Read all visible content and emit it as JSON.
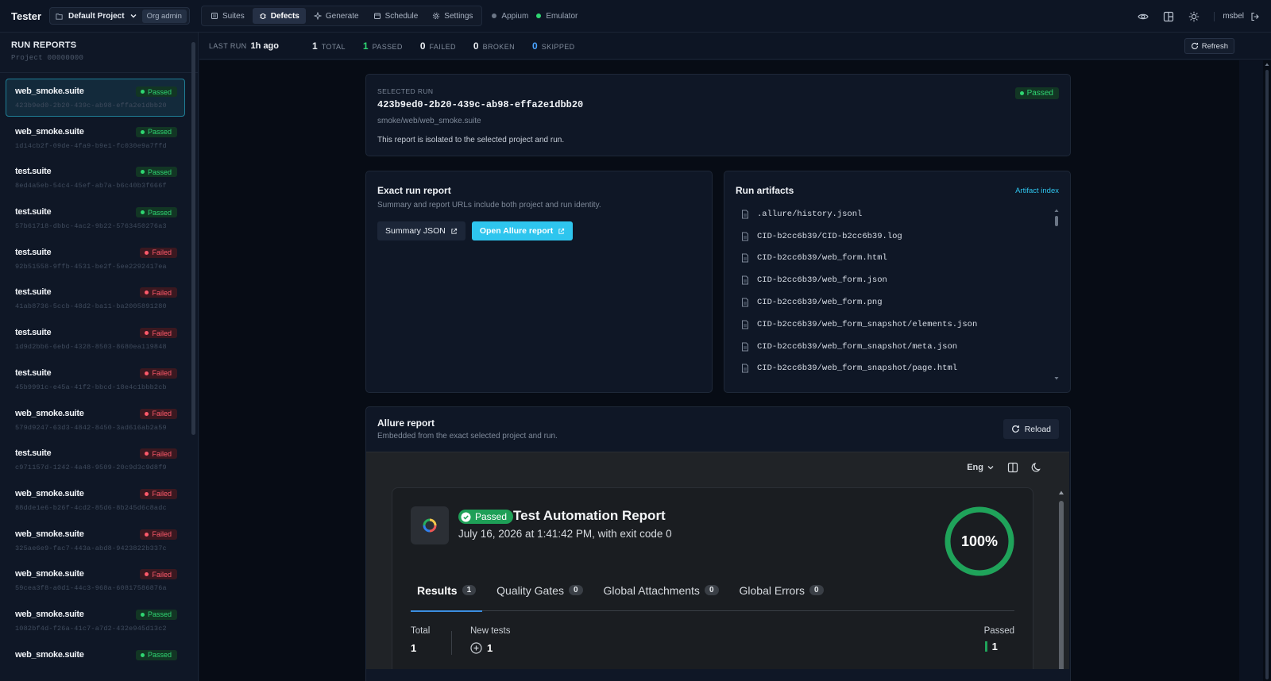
{
  "app": {
    "brand": "Tester"
  },
  "project": {
    "name": "Default Project",
    "org_badge": "Org admin"
  },
  "nav": [
    {
      "label": "Suites",
      "icon": "list-icon",
      "active": false
    },
    {
      "label": "Defects",
      "icon": "bug-icon",
      "active": true
    },
    {
      "label": "Generate",
      "icon": "sparkle-icon",
      "active": false
    },
    {
      "label": "Schedule",
      "icon": "calendar-icon",
      "active": false
    },
    {
      "label": "Settings",
      "icon": "gear-icon",
      "active": false
    }
  ],
  "devices": [
    {
      "label": "Appium",
      "color": "#6b7686"
    },
    {
      "label": "Emulator",
      "color": "#2fd672"
    }
  ],
  "user": {
    "name": "msbel"
  },
  "sidebar": {
    "title": "RUN REPORTS",
    "subtitle": "Project 00000000",
    "runs": [
      {
        "suite": "web_smoke.suite",
        "id": "423b9ed0-2b20-439c-ab98-effa2e1dbb20",
        "status": "Passed",
        "kind": "passed",
        "selected": true
      },
      {
        "suite": "web_smoke.suite",
        "id": "1d14cb2f-09de-4fa9-b9e1-fc030e9a7ffd",
        "status": "Passed",
        "kind": "passed"
      },
      {
        "suite": "test.suite",
        "id": "8ed4a5eb-54c4-45ef-ab7a-b6c40b3f666f",
        "status": "Passed",
        "kind": "passed"
      },
      {
        "suite": "test.suite",
        "id": "57b61718-dbbc-4ac2-9b22-5763450276a3",
        "status": "Passed",
        "kind": "passed"
      },
      {
        "suite": "test.suite",
        "id": "92b51558-9ffb-4531-be2f-5ee2292417ea",
        "status": "Failed",
        "kind": "failed"
      },
      {
        "suite": "test.suite",
        "id": "41ab8736-5ccb-48d2-ba11-ba2005891280",
        "status": "Failed",
        "kind": "failed"
      },
      {
        "suite": "test.suite",
        "id": "1d9d2bb6-6ebd-4328-8503-8680ea119848",
        "status": "Failed",
        "kind": "failed"
      },
      {
        "suite": "test.suite",
        "id": "45b9991c-e45a-41f2-bbcd-18e4c1bbb2cb",
        "status": "Failed",
        "kind": "failed"
      },
      {
        "suite": "web_smoke.suite",
        "id": "579d9247-63d3-4842-8450-3ad616ab2a59",
        "status": "Failed",
        "kind": "failed"
      },
      {
        "suite": "test.suite",
        "id": "c971157d-1242-4a48-9509-20c9d3c9d8f9",
        "status": "Failed",
        "kind": "failed"
      },
      {
        "suite": "web_smoke.suite",
        "id": "88dde1e6-b26f-4cd2-85d6-8b245d6c8adc",
        "status": "Failed",
        "kind": "failed"
      },
      {
        "suite": "web_smoke.suite",
        "id": "325ae6e9-fac7-443a-abd8-9423822b337c",
        "status": "Failed",
        "kind": "failed"
      },
      {
        "suite": "web_smoke.suite",
        "id": "59cea3f8-a0d1-44c3-968a-60817586876a",
        "status": "Failed",
        "kind": "failed"
      },
      {
        "suite": "web_smoke.suite",
        "id": "1082bf4d-f26a-41c7-a7d2-432e945d13c2",
        "status": "Passed",
        "kind": "passed"
      },
      {
        "suite": "web_smoke.suite",
        "id": "",
        "status": "Passed",
        "kind": "passed"
      }
    ]
  },
  "summary": {
    "last_run_label": "LAST RUN",
    "last_run_value": "1h ago",
    "stats": [
      {
        "num": "1",
        "label": "TOTAL",
        "color": "#e8ecf1"
      },
      {
        "num": "1",
        "label": "PASSED",
        "color": "#2fd672"
      },
      {
        "num": "0",
        "label": "FAILED",
        "color": "#e8ecf1"
      },
      {
        "num": "0",
        "label": "BROKEN",
        "color": "#e8ecf1"
      },
      {
        "num": "0",
        "label": "SKIPPED",
        "color": "#4aa3ff"
      }
    ],
    "refresh_label": "Refresh"
  },
  "selected_run": {
    "label": "SELECTED RUN",
    "id": "423b9ed0-2b20-439c-ab98-effa2e1dbb20",
    "path": "smoke/web/web_smoke.suite",
    "note": "This report is isolated to the selected project and run.",
    "status": "Passed"
  },
  "exact_report": {
    "title": "Exact run report",
    "subtitle": "Summary and report URLs include both project and run identity.",
    "summary_btn": "Summary JSON",
    "open_btn": "Open Allure report"
  },
  "artifacts": {
    "title": "Run artifacts",
    "index_link": "Artifact index",
    "files": [
      ".allure/history.jsonl",
      "CID-b2cc6b39/CID-b2cc6b39.log",
      "CID-b2cc6b39/web_form.html",
      "CID-b2cc6b39/web_form.json",
      "CID-b2cc6b39/web_form.png",
      "CID-b2cc6b39/web_form_snapshot/elements.json",
      "CID-b2cc6b39/web_form_snapshot/meta.json",
      "CID-b2cc6b39/web_form_snapshot/page.html"
    ]
  },
  "allure": {
    "title": "Allure report",
    "subtitle": "Embedded from the exact selected project and run.",
    "reload_btn": "Reload",
    "lang": "Eng",
    "status": "Passed",
    "report_title": "Test Automation Report",
    "date_line": "July 16, 2026 at 1:41:42 PM, with exit code 0",
    "percent": "100%",
    "percent_value": 100,
    "tabs": [
      {
        "label": "Results",
        "count": "1",
        "active": true
      },
      {
        "label": "Quality Gates",
        "count": "0"
      },
      {
        "label": "Global Attachments",
        "count": "0"
      },
      {
        "label": "Global Errors",
        "count": "0"
      }
    ],
    "metrics": {
      "total_label": "Total",
      "total_value": "1",
      "new_label": "New tests",
      "new_value": "1",
      "passed_label": "Passed",
      "passed_value": "1"
    }
  }
}
